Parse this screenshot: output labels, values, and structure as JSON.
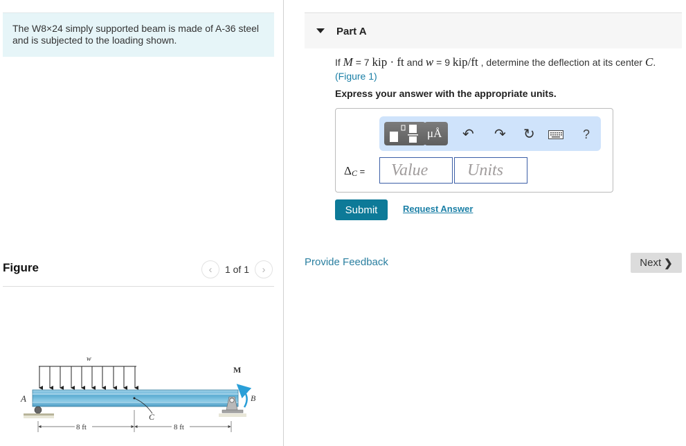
{
  "problem": {
    "statement": "The W8×24 simply supported beam is made of A-36 steel and is subjected to the loading shown."
  },
  "figure": {
    "title": "Figure",
    "pager": {
      "text": "1 of 1",
      "prev_icon": "chevron-left",
      "next_icon": "chevron-right"
    },
    "labels": {
      "distributed_load": "w",
      "moment": "M",
      "support_a": "A",
      "support_b": "B",
      "center": "C",
      "span_left": "8 ft",
      "span_right": "8 ft"
    },
    "colors": {
      "beam": "#6fb6d6",
      "beam_dark": "#3e8fb5",
      "moment_arrow": "#2a9fd8",
      "support": "#a8a8a8"
    }
  },
  "part": {
    "title": "Part A",
    "question_prefix": "If ",
    "M_symbol": "M",
    "M_value": " = 7 ",
    "M_unit": "kip · ft",
    "and": " and ",
    "w_symbol": "w",
    "w_value": " = 9 ",
    "w_unit": "kip/ft",
    "question_suffix": " , determine the deflection at its center ",
    "C_symbol": "C",
    "period": ".",
    "figure_link": "(Figure 1)",
    "instruction": "Express your answer with the appropriate units."
  },
  "answer": {
    "label_symbol": "Δ",
    "label_sub": "C",
    "label_eq": " =",
    "value_placeholder": "Value",
    "units_placeholder": "Units",
    "toolbar": {
      "templates_icon": "fraction-templates-icon",
      "units_label": "μÅ",
      "undo_icon": "↶",
      "redo_icon": "↷",
      "reset_icon": "↻",
      "keyboard_icon": "⌨",
      "help_label": "?"
    }
  },
  "actions": {
    "submit": "Submit",
    "request_answer": "Request Answer",
    "provide_feedback": "Provide Feedback",
    "next": "Next",
    "next_chevron": "❯"
  },
  "colors": {
    "accent": "#0d7a98",
    "link": "#1a7fa6",
    "problem_bg": "#e6f5f8",
    "toolbar_bg": "#cfe3fb"
  }
}
